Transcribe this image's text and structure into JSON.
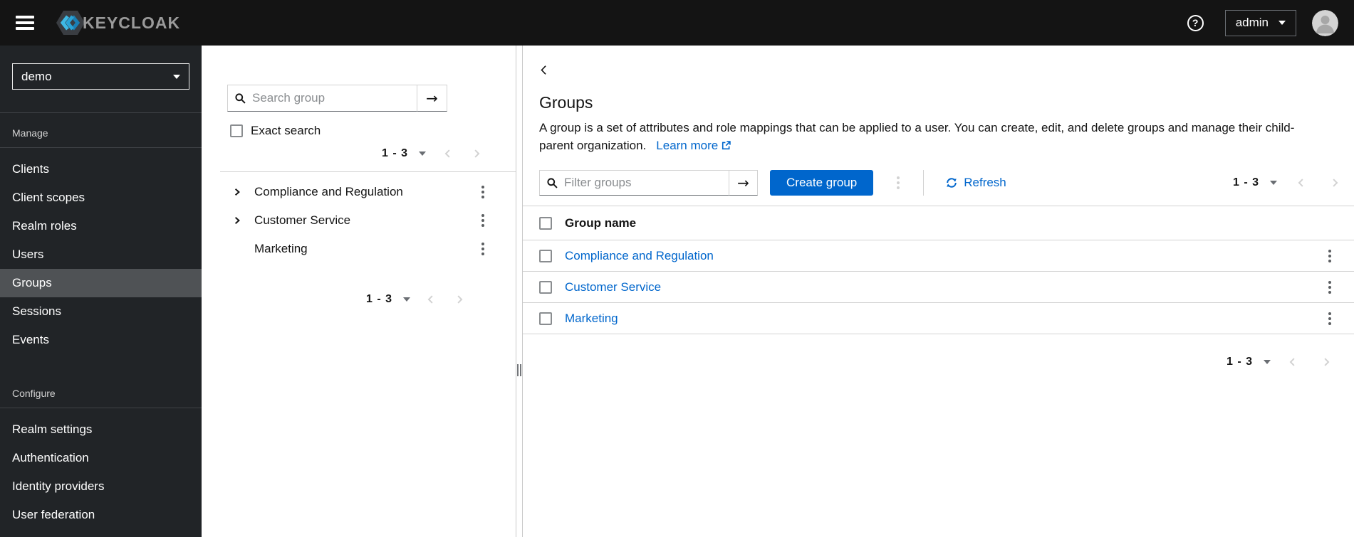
{
  "topbar": {
    "brand": "KEYCLOAK",
    "username": "admin"
  },
  "sidebar": {
    "realm": "demo",
    "manage_label": "Manage",
    "configure_label": "Configure",
    "manage_items": [
      "Clients",
      "Client scopes",
      "Realm roles",
      "Users",
      "Groups",
      "Sessions",
      "Events"
    ],
    "configure_items": [
      "Realm settings",
      "Authentication",
      "Identity providers",
      "User federation"
    ],
    "selected_item": "Groups"
  },
  "groups_tree": {
    "search_placeholder": "Search group",
    "submit_arrow": "→",
    "exact_search_label": "Exact search",
    "pagination_range": "1 - 3",
    "items": [
      "Compliance and Regulation",
      "Customer Service",
      "Marketing"
    ]
  },
  "main": {
    "title": "Groups",
    "description": "A group is a set of attributes and role mappings that can be applied to a user. You can create, edit, and delete groups and manage their child-parent organization.",
    "learn_more_label": "Learn more",
    "toolbar": {
      "filter_placeholder": "Filter groups",
      "submit_arrow": "→",
      "create_group_label": "Create group",
      "refresh_label": "Refresh",
      "pagination_range": "1 - 3"
    },
    "table": {
      "header": "Group name",
      "rows": [
        "Compliance and Regulation",
        "Customer Service",
        "Marketing"
      ]
    },
    "pagination_range": "1 - 3"
  },
  "colors": {
    "primary": "#0066cc",
    "link": "#0066cc",
    "masthead": "#141414",
    "sidebar_bg": "#212427",
    "sidebar_selected": "#4f5255"
  }
}
